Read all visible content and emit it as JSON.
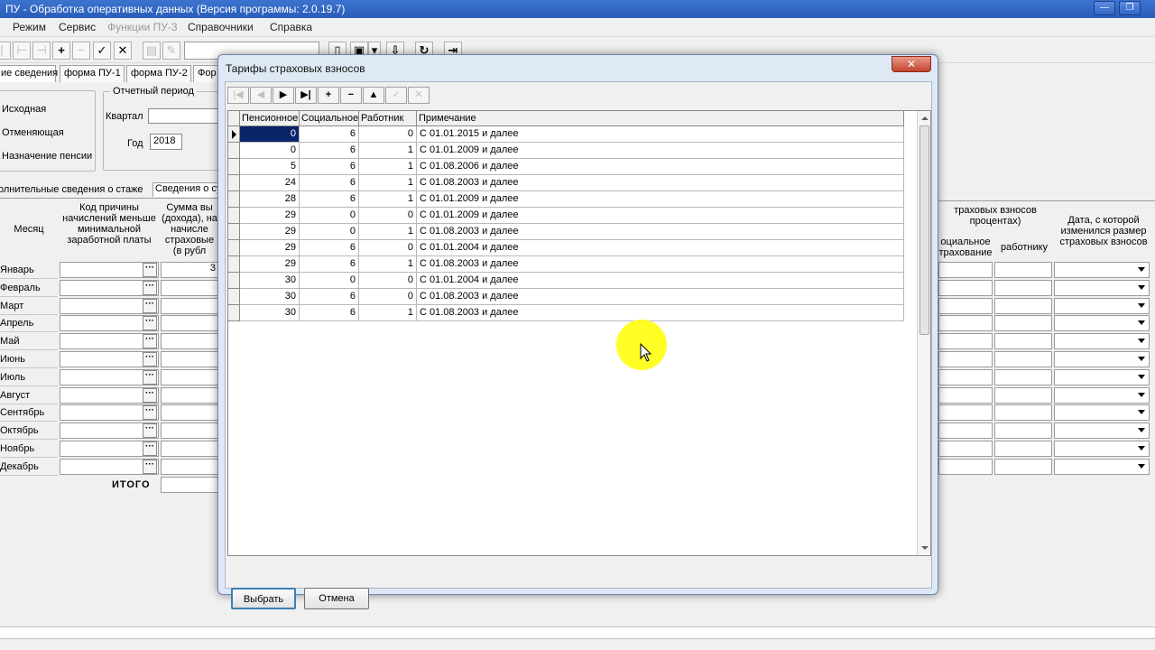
{
  "window": {
    "title": "ПУ - Обработка оперативных данных (Версия программы: 2.0.19.7)",
    "min_glyph": "—",
    "max_glyph": "❐"
  },
  "menu": [
    {
      "label": "Режим",
      "enabled": true
    },
    {
      "label": "Сервис",
      "enabled": true
    },
    {
      "label": "Функции ПУ-3",
      "enabled": false
    },
    {
      "label": "Справочники",
      "enabled": true
    },
    {
      "label": "Справка",
      "enabled": true
    }
  ],
  "toolbar": {
    "add": "+",
    "remove": "−",
    "confirm": "✓",
    "cancel": "✕"
  },
  "tabs": [
    {
      "label": "ие сведения"
    },
    {
      "label": "форма ПУ-1"
    },
    {
      "label": "форма ПУ-2"
    },
    {
      "label": "Фор"
    }
  ],
  "form": {
    "doc_type_options": [
      "Исходная",
      "Отменяющая",
      "Назначение пенсии"
    ],
    "period_group": "Отчетный период",
    "quarter_label": "Квартал",
    "quarter_value": "",
    "year_label": "Год",
    "year_value": "2018",
    "subtab_extra": "олнительные сведения о стаже",
    "subtab_summary": "Сведения о су"
  },
  "bg_table": {
    "month_header": "Месяц",
    "reason_header": "Код причины начислений меньше минимальной заработной платы",
    "sum_header": "Сумма вы (дохода), на начисле страховые (в рубл",
    "rates_header": "траховых взносов процентах)",
    "social_header": "оциальное трахование",
    "worker_header": "работнику",
    "date_header": "Дата, с которой изменился размер страховых взносов",
    "months": [
      "Январь",
      "Февраль",
      "Март",
      "Апрель",
      "Май",
      "Июнь",
      "Июль",
      "Август",
      "Сентябрь",
      "Октябрь",
      "Ноябрь",
      "Декабрь"
    ],
    "jan_sum_fragment": "3",
    "total_label": "ИТОГО",
    "dots": "···"
  },
  "dialog": {
    "title": "Тарифы страховых взносов",
    "close_glyph": "✕",
    "nav": [
      "|◀",
      "◀",
      "▶",
      "▶|",
      "+",
      "−",
      "▲",
      "✓",
      "✕"
    ],
    "columns": [
      "Пенсионное",
      "Социальное",
      "Работник",
      "Примечание"
    ],
    "rows": [
      {
        "pension": "0",
        "social": "6",
        "worker": "0",
        "note": "С 01.01.2015 и далее"
      },
      {
        "pension": "0",
        "social": "6",
        "worker": "1",
        "note": "С 01.01.2009 и далее"
      },
      {
        "pension": "5",
        "social": "6",
        "worker": "1",
        "note": "С 01.08.2006 и далее"
      },
      {
        "pension": "24",
        "social": "6",
        "worker": "1",
        "note": "С 01.08.2003 и далее"
      },
      {
        "pension": "28",
        "social": "6",
        "worker": "1",
        "note": "С 01.01.2009 и далее"
      },
      {
        "pension": "29",
        "social": "0",
        "worker": "0",
        "note": "С 01.01.2009 и далее"
      },
      {
        "pension": "29",
        "social": "0",
        "worker": "1",
        "note": "С 01.08.2003 и далее"
      },
      {
        "pension": "29",
        "social": "6",
        "worker": "0",
        "note": "С 01.01.2004 и далее"
      },
      {
        "pension": "29",
        "social": "6",
        "worker": "1",
        "note": "С 01.08.2003 и далее"
      },
      {
        "pension": "30",
        "social": "0",
        "worker": "0",
        "note": "С 01.01.2004 и далее"
      },
      {
        "pension": "30",
        "social": "6",
        "worker": "0",
        "note": "С 01.08.2003 и далее"
      },
      {
        "pension": "30",
        "social": "6",
        "worker": "1",
        "note": "С 01.08.2003 и далее"
      }
    ],
    "selected_row": 0,
    "ok_label": "Выбрать",
    "cancel_label": "Отмена"
  }
}
